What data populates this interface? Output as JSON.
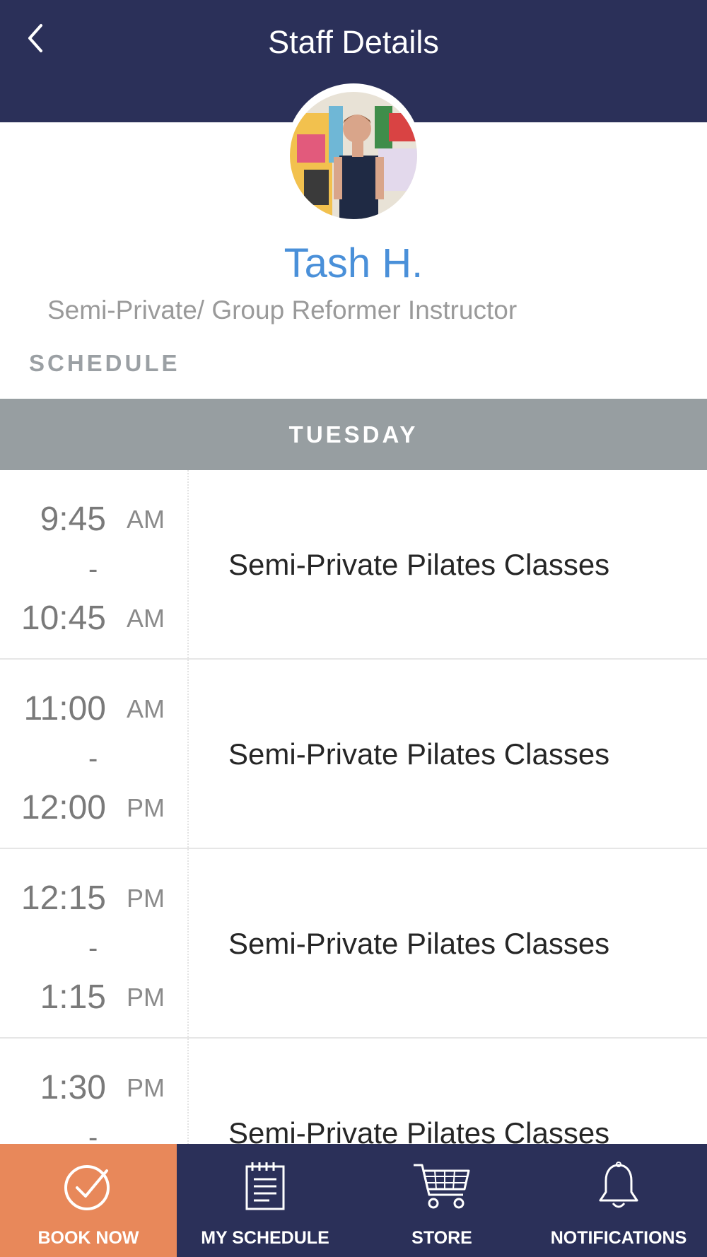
{
  "header": {
    "title": "Staff Details",
    "back_icon": "chevron-left-icon"
  },
  "staff": {
    "name": "Tash H.",
    "role": "Semi-Private/ Group Reformer Instructor"
  },
  "schedule": {
    "label": "SCHEDULE",
    "day": "TUESDAY",
    "items": [
      {
        "start": "9:45",
        "start_ampm": "AM",
        "separator": "-",
        "end": "10:45",
        "end_ampm": "AM",
        "class_name": "Semi-Private Pilates Classes"
      },
      {
        "start": "11:00",
        "start_ampm": "AM",
        "separator": "-",
        "end": "12:00",
        "end_ampm": "PM",
        "class_name": "Semi-Private Pilates Classes"
      },
      {
        "start": "12:15",
        "start_ampm": "PM",
        "separator": "-",
        "end": "1:15",
        "end_ampm": "PM",
        "class_name": "Semi-Private Pilates Classes"
      },
      {
        "start": "1:30",
        "start_ampm": "PM",
        "separator": "-",
        "end": "",
        "end_ampm": "",
        "class_name": "Semi-Private Pilates Classes"
      }
    ]
  },
  "tabbar": {
    "tabs": [
      {
        "label": "BOOK NOW",
        "icon": "check-circle-icon",
        "active": true
      },
      {
        "label": "MY SCHEDULE",
        "icon": "calendar-icon",
        "active": false
      },
      {
        "label": "STORE",
        "icon": "cart-icon",
        "active": false
      },
      {
        "label": "NOTIFICATIONS",
        "icon": "bell-icon",
        "active": false
      }
    ]
  },
  "colors": {
    "header_bg": "#2b3059",
    "accent_name": "#4a90d9",
    "day_bar_bg": "#979ea1",
    "active_tab_bg": "#e8885a"
  }
}
